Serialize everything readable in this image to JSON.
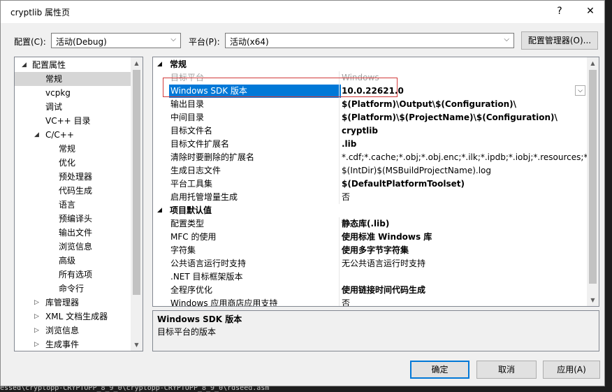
{
  "background": {
    "lines": [
      "0",
      "o",
      "s"
    ],
    "bottom_path": "essed\\cryptopp-CRYPTOPP_8_9_0\\cryptopp-CRYPTOPP_8_9_0\\rdseed.asm"
  },
  "window": {
    "title": "cryptlib 属性页",
    "help_label": "?",
    "close_label": "✕"
  },
  "top": {
    "config_label": "配置(C):",
    "config_value": "活动(Debug)",
    "platform_label": "平台(P):",
    "platform_value": "活动(x64)",
    "manager_button": "配置管理器(O)..."
  },
  "tree": {
    "root": "配置属性",
    "items": [
      {
        "label": "常规",
        "selected": true
      },
      {
        "label": "vcpkg"
      },
      {
        "label": "调试"
      },
      {
        "label": "VC++ 目录"
      }
    ],
    "cpp": {
      "label": "C/C++",
      "children": [
        "常规",
        "优化",
        "预处理器",
        "代码生成",
        "语言",
        "预编译头",
        "输出文件",
        "浏览信息",
        "高级",
        "所有选项",
        "命令行"
      ]
    },
    "collapsed": [
      "库管理器",
      "XML 文档生成器",
      "浏览信息",
      "生成事件"
    ]
  },
  "grid": {
    "categories": [
      {
        "label": "常规",
        "rows": [
          {
            "name": "目标平台",
            "value": "Windows",
            "style": "grey"
          },
          {
            "name": "Windows SDK 版本",
            "value": "10.0.22621.0",
            "style": "selected"
          },
          {
            "name": "输出目录",
            "value": "$(Platform)\\Output\\$(Configuration)\\",
            "style": "bold"
          },
          {
            "name": "中间目录",
            "value": "$(Platform)\\$(ProjectName)\\$(Configuration)\\",
            "style": "bold"
          },
          {
            "name": "目标文件名",
            "value": "cryptlib",
            "style": "bold"
          },
          {
            "name": "目标文件扩展名",
            "value": ".lib",
            "style": "bold"
          },
          {
            "name": "清除时要删除的扩展名",
            "value": "*.cdf;*.cache;*.obj;*.obj.enc;*.ilk;*.ipdb;*.iobj;*.resources;*.tlb;*",
            "style": "normal"
          },
          {
            "name": "生成日志文件",
            "value": "$(IntDir)$(MSBuildProjectName).log",
            "style": "normal"
          },
          {
            "name": "平台工具集",
            "value": "$(DefaultPlatformToolset)",
            "style": "bold"
          },
          {
            "name": "启用托管增量生成",
            "value": "否",
            "style": "normal"
          }
        ]
      },
      {
        "label": "项目默认值",
        "rows": [
          {
            "name": "配置类型",
            "value": "静态库(.lib)",
            "style": "bold"
          },
          {
            "name": "MFC 的使用",
            "value": "使用标准 Windows 库",
            "style": "bold"
          },
          {
            "name": "字符集",
            "value": "使用多字节字符集",
            "style": "bold"
          },
          {
            "name": "公共语言运行时支持",
            "value": "无公共语言运行时支持",
            "style": "normal"
          },
          {
            "name": ".NET 目标框架版本",
            "value": "",
            "style": "normal"
          },
          {
            "name": "全程序优化",
            "value": "使用链接时间代码生成",
            "style": "bold"
          },
          {
            "name": "Windows 应用商店应用支持",
            "value": "否",
            "style": "normal"
          }
        ]
      }
    ]
  },
  "description": {
    "title": "Windows SDK 版本",
    "text": "目标平台的版本"
  },
  "buttons": {
    "ok": "确定",
    "cancel": "取消",
    "apply": "应用(A)"
  },
  "colors": {
    "selection": "#0078d7",
    "highlight_box": "#d23a3a",
    "tree_selection": "#d6d6d6"
  }
}
